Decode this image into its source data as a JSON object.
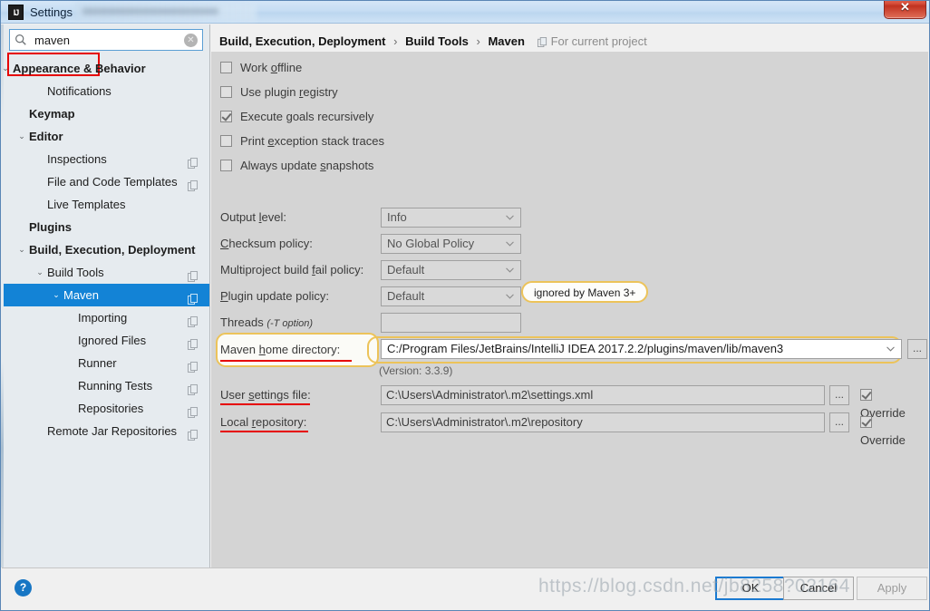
{
  "window": {
    "title": "Settings",
    "app_icon": "intellij-idea-icon",
    "close_label": "✕"
  },
  "search": {
    "value": "maven",
    "placeholder": "",
    "icon": "search-icon",
    "clear_icon": "clear-icon"
  },
  "sidebar": {
    "items": [
      {
        "label": "Appearance & Behavior",
        "indent": 12,
        "bold": true,
        "chevron": "⌄",
        "copy": false,
        "selected": false
      },
      {
        "label": "Notifications",
        "indent": 50,
        "bold": false,
        "chevron": "",
        "copy": false,
        "selected": false
      },
      {
        "label": "Keymap",
        "indent": 30,
        "bold": true,
        "chevron": "",
        "copy": false,
        "selected": false
      },
      {
        "label": "Editor",
        "indent": 30,
        "bold": true,
        "chevron": "⌄",
        "copy": false,
        "selected": false
      },
      {
        "label": "Inspections",
        "indent": 50,
        "bold": false,
        "chevron": "",
        "copy": true,
        "selected": false
      },
      {
        "label": "File and Code Templates",
        "indent": 50,
        "bold": false,
        "chevron": "",
        "copy": true,
        "selected": false
      },
      {
        "label": "Live Templates",
        "indent": 50,
        "bold": false,
        "chevron": "",
        "copy": false,
        "selected": false
      },
      {
        "label": "Plugins",
        "indent": 30,
        "bold": true,
        "chevron": "",
        "copy": false,
        "selected": false
      },
      {
        "label": "Build, Execution, Deployment",
        "indent": 30,
        "bold": true,
        "chevron": "⌄",
        "copy": false,
        "selected": false
      },
      {
        "label": "Build Tools",
        "indent": 50,
        "bold": false,
        "chevron": "⌄",
        "copy": true,
        "selected": false
      },
      {
        "label": "Maven",
        "indent": 68,
        "bold": false,
        "chevron": "⌄",
        "copy": true,
        "selected": true
      },
      {
        "label": "Importing",
        "indent": 84,
        "bold": false,
        "chevron": "",
        "copy": true,
        "selected": false
      },
      {
        "label": "Ignored Files",
        "indent": 84,
        "bold": false,
        "chevron": "",
        "copy": true,
        "selected": false
      },
      {
        "label": "Runner",
        "indent": 84,
        "bold": false,
        "chevron": "",
        "copy": true,
        "selected": false
      },
      {
        "label": "Running Tests",
        "indent": 84,
        "bold": false,
        "chevron": "",
        "copy": true,
        "selected": false
      },
      {
        "label": "Repositories",
        "indent": 84,
        "bold": false,
        "chevron": "",
        "copy": true,
        "selected": false
      },
      {
        "label": "Remote Jar Repositories",
        "indent": 50,
        "bold": false,
        "chevron": "",
        "copy": true,
        "selected": false
      }
    ]
  },
  "breadcrumb": {
    "part1": "Build, Execution, Deployment",
    "part2": "Build Tools",
    "part3": "Maven",
    "separator": "›",
    "scope": "For current project",
    "scope_icon": "copy-icon"
  },
  "checkboxes": [
    {
      "label_pre": "Work ",
      "mnemonic": "o",
      "label_post": "ffline",
      "checked": false
    },
    {
      "label_pre": "Use plugin ",
      "mnemonic": "r",
      "label_post": "egistry",
      "checked": false
    },
    {
      "label_pre": "Execute ",
      "mnemonic": "g",
      "label_post": "oals recursively",
      "checked": true
    },
    {
      "label_pre": "Print ",
      "mnemonic": "e",
      "label_post": "xception stack traces",
      "checked": false
    },
    {
      "label_pre": "Always update ",
      "mnemonic": "s",
      "label_post": "napshots",
      "checked": false
    }
  ],
  "fields": {
    "output_level": {
      "label_pre": "Output ",
      "mnemonic": "l",
      "label_post": "evel:",
      "value": "Info"
    },
    "checksum": {
      "label_pre": "",
      "mnemonic": "C",
      "label_post": "hecksum policy:",
      "value": "No Global Policy"
    },
    "multiproject": {
      "label_pre": "Multiproject build ",
      "mnemonic": "f",
      "label_post": "ail policy:",
      "value": "Default"
    },
    "plugin_update": {
      "label_pre": "",
      "mnemonic": "P",
      "label_post": "lugin update policy:",
      "value": "Default"
    },
    "threads": {
      "label": "Threads",
      "hint": "(-T option)",
      "value": ""
    },
    "maven_home": {
      "label_pre": "Maven ",
      "mnemonic": "h",
      "label_post": "ome directory:",
      "value": "C:/Program Files/JetBrains/IntelliJ IDEA 2017.2.2/plugins/maven/lib/maven3",
      "version": "(Version: 3.3.9)",
      "browse": "..."
    },
    "user_settings": {
      "label_pre": "User ",
      "mnemonic": "s",
      "label_post": "ettings file:",
      "value": "C:\\Users\\Administrator\\.m2\\settings.xml",
      "browse": "...",
      "override_label": "Override",
      "override_checked": true
    },
    "local_repo": {
      "label_pre": "Local ",
      "mnemonic": "r",
      "label_post": "epository:",
      "value": "C:\\Users\\Administrator\\.m2\\repository",
      "browse": "...",
      "override_label": "Override",
      "override_checked": true
    }
  },
  "tooltip": {
    "text": "ignored by Maven 3+"
  },
  "buttons": {
    "help": "?",
    "ok": "OK",
    "cancel": "Cancel",
    "apply": "Apply"
  },
  "watermark": {
    "text": "https://blog.csdn.net/jb8258?02164"
  },
  "colors": {
    "selection_blue": "#1383d6",
    "annotation_red": "#e60000",
    "highlight_yellow": "#ecc35a",
    "content_bg": "#d4d4d4",
    "sidebar_bg": "#e6ebef"
  }
}
